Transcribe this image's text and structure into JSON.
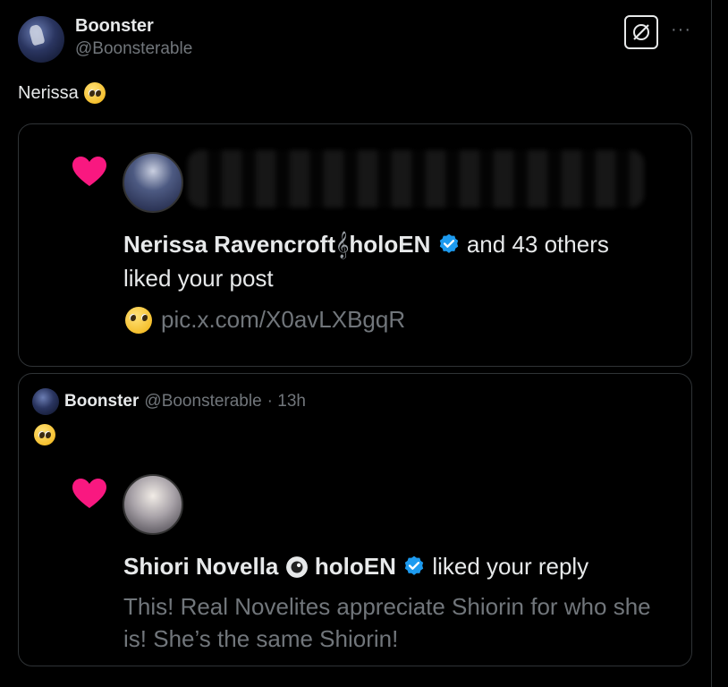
{
  "header": {
    "display_name": "Boonster",
    "handle": "@Boonsterable",
    "more": "···"
  },
  "tweet": {
    "text": "Nerissa"
  },
  "quote1": {
    "actor_name": "Nerissa Ravencroft",
    "actor_suffix": "holoEN",
    "and_others": "and 43 others",
    "action": "liked your post",
    "link": "pic.x.com/X0avLXBgqR",
    "icons": [
      "heart-icon",
      "treble-clef-icon",
      "verified-icon",
      "pleading-face-icon"
    ],
    "colors": {
      "heart": "#f91880",
      "verified": "#1d9bf0"
    }
  },
  "quote2": {
    "display_name": "Boonster",
    "handle": "@Boonsterable",
    "time": "· 13h",
    "actor_name": "Shiori Novella",
    "actor_suffix": "holoEN",
    "action": "liked your reply",
    "reply_text": "This! Real Novelites appreciate Shiorin for who she is! She’s the same Shiorin!"
  }
}
